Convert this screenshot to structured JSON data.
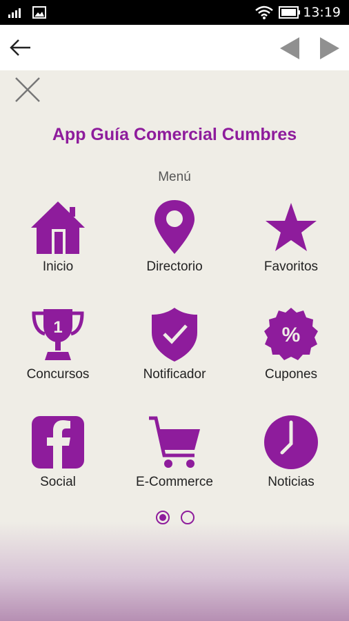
{
  "status_bar": {
    "time": "13:19"
  },
  "colors": {
    "accent": "#8e1c9c",
    "background": "#efede6"
  },
  "header": {
    "title": "App Guía Comercial Cumbres",
    "subtitle": "Menú"
  },
  "menu": {
    "items": [
      {
        "label": "Inicio",
        "icon": "home-icon"
      },
      {
        "label": "Directorio",
        "icon": "location-pin-icon"
      },
      {
        "label": "Favoritos",
        "icon": "star-icon"
      },
      {
        "label": "Concursos",
        "icon": "trophy-icon"
      },
      {
        "label": "Notificador",
        "icon": "shield-check-icon"
      },
      {
        "label": "Cupones",
        "icon": "percent-badge-icon"
      },
      {
        "label": "Social",
        "icon": "facebook-icon"
      },
      {
        "label": "E-Commerce",
        "icon": "shopping-cart-icon"
      },
      {
        "label": "Noticias",
        "icon": "clock-icon"
      }
    ],
    "trophy_text": "1",
    "coupon_text": "%"
  },
  "pagination": {
    "current": 1,
    "total": 2
  }
}
